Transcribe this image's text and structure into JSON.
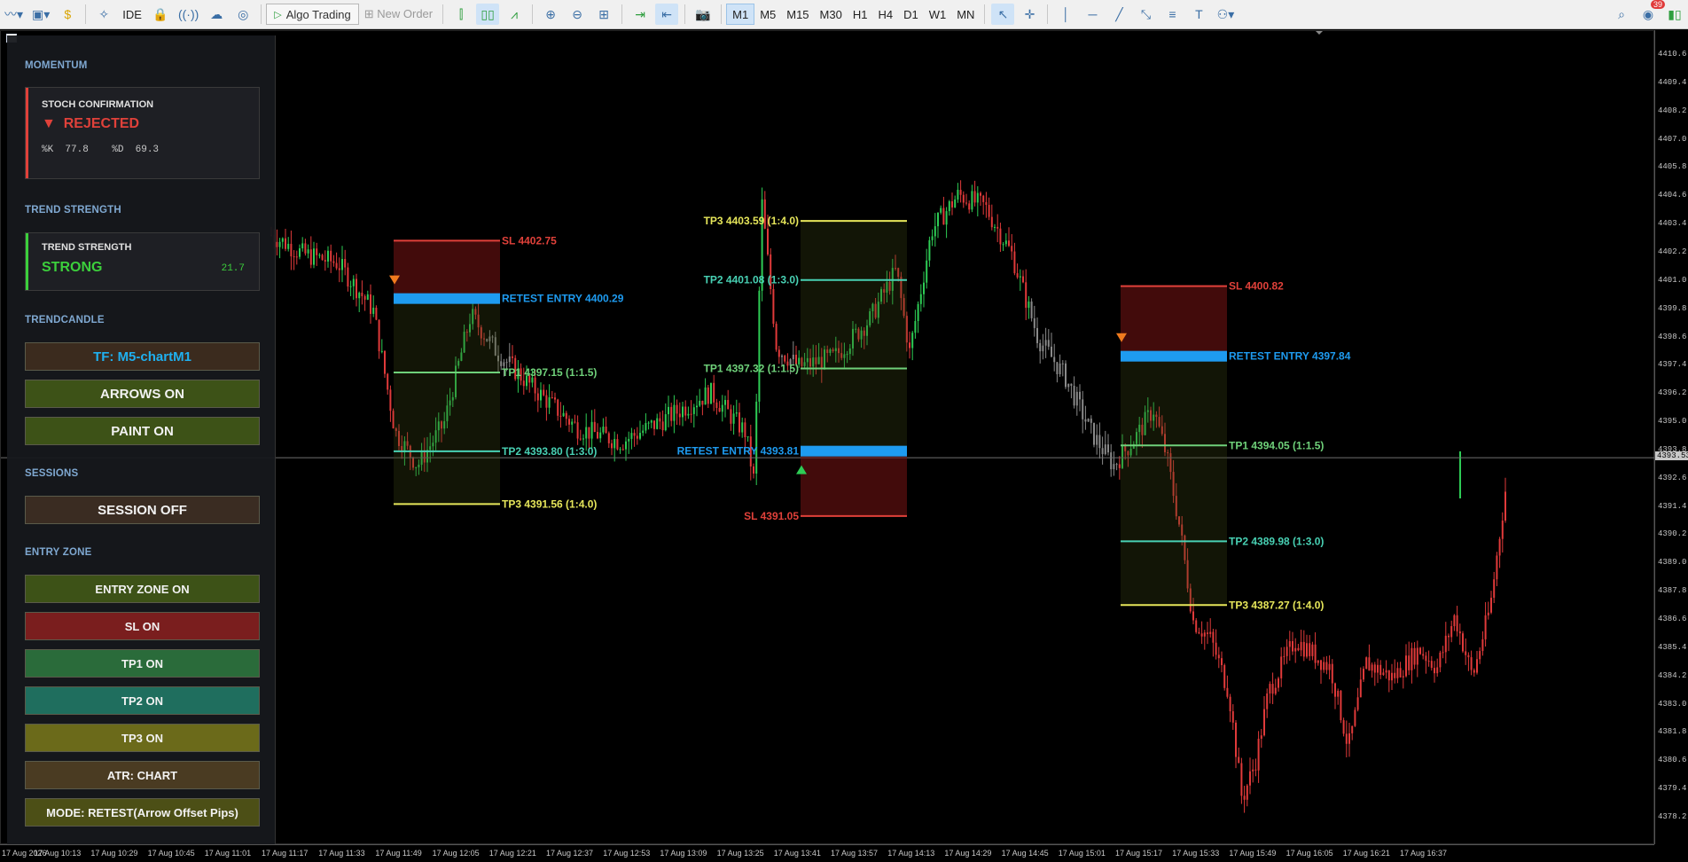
{
  "toolbar": {
    "algo_trading": "Algo Trading",
    "new_order": "New Order",
    "ide": "IDE",
    "timeframes": [
      "M1",
      "M5",
      "M15",
      "M30",
      "H1",
      "H4",
      "D1",
      "W1",
      "MN"
    ],
    "active_timeframe": "M1",
    "notification_count": "39"
  },
  "panel": {
    "momentum": {
      "section": "MOMENTUM",
      "card_title": "STOCH CONFIRMATION",
      "status": "REJECTED",
      "status_arrow": "▼",
      "k_label": "%K",
      "k_value": "77.8",
      "d_label": "%D",
      "d_value": "69.3",
      "color": "#e0413a"
    },
    "trend": {
      "section": "TREND STRENGTH",
      "card_title": "TREND STRENGTH",
      "status": "STRONG",
      "value": "21.7",
      "color": "#3ccf3c"
    },
    "trendcandle": {
      "section": "TRENDCANDLE",
      "tf_button": "TF: M5-chartM1",
      "arrows_button": "ARROWS ON",
      "paint_button": "PAINT ON"
    },
    "sessions": {
      "section": "SESSIONS",
      "session_button": "SESSION OFF"
    },
    "entry_zone": {
      "section": "ENTRY ZONE",
      "entry_button": "ENTRY ZONE ON",
      "sl_button": "SL  ON",
      "tp1_button": "TP1  ON",
      "tp2_button": "TP2  ON",
      "tp3_button": "TP3  ON",
      "atr_button": "ATR: CHART",
      "mode_button": "MODE: RETEST(Arrow Offset Pips)"
    }
  },
  "trades": [
    {
      "sl": "SL  4402.75",
      "entry": "RETEST ENTRY 4400.29",
      "tp1": "TP1  4397.15  (1:1.5)",
      "tp2": "TP2  4393.80  (1:3.0)",
      "tp3": "TP3  4391.56  (1:4.0)"
    },
    {
      "sl": "SL  4391.05",
      "entry": "RETEST ENTRY 4393.81",
      "tp1": "TP1  4397.32  (1:1.5)",
      "tp2": "TP2  4401.08  (1:3.0)",
      "tp3": "TP3  4403.59  (1:4.0)"
    },
    {
      "sl": "SL  4400.82",
      "entry": "RETEST ENTRY 4397.84",
      "tp1": "TP1  4394.05  (1:1.5)",
      "tp2": "TP2  4389.98  (1:3.0)",
      "tp3": "TP3  4387.27  (1:4.0)"
    }
  ],
  "price_axis": [
    "4410.6",
    "4409.4",
    "4408.2",
    "4407.0",
    "4405.8",
    "4404.6",
    "4403.4",
    "4402.2",
    "4401.0",
    "4399.8",
    "4398.6",
    "4397.4",
    "4396.2",
    "4395.0",
    "4393.8",
    "4392.6",
    "4391.4",
    "4390.2",
    "4389.0",
    "4387.8",
    "4386.6",
    "4385.4",
    "4384.2",
    "4383.0",
    "4381.8",
    "4380.6",
    "4379.4",
    "4378.2"
  ],
  "current_price": "4393.53",
  "time_axis": [
    "17 Aug 2026",
    "17 Aug 10:13",
    "17 Aug 10:29",
    "17 Aug 10:45",
    "17 Aug 11:01",
    "17 Aug 11:17",
    "17 Aug 11:33",
    "17 Aug 11:49",
    "17 Aug 12:05",
    "17 Aug 12:21",
    "17 Aug 12:37",
    "17 Aug 12:53",
    "17 Aug 13:09",
    "17 Aug 13:25",
    "17 Aug 13:41",
    "17 Aug 13:57",
    "17 Aug 14:13",
    "17 Aug 14:29",
    "17 Aug 14:45",
    "17 Aug 15:01",
    "17 Aug 15:17",
    "17 Aug 15:33",
    "17 Aug 15:49",
    "17 Aug 16:05",
    "17 Aug 16:21",
    "17 Aug 16:37"
  ],
  "colors": {
    "sl": "#e0413a",
    "entry": "#1e9bf0",
    "tp1": "#6fd17a",
    "tp2": "#48d1b4",
    "tp3": "#e6e65a",
    "bull": "#2ecc55",
    "bear": "#e03a3a",
    "neutral": "#8a8a8a"
  }
}
